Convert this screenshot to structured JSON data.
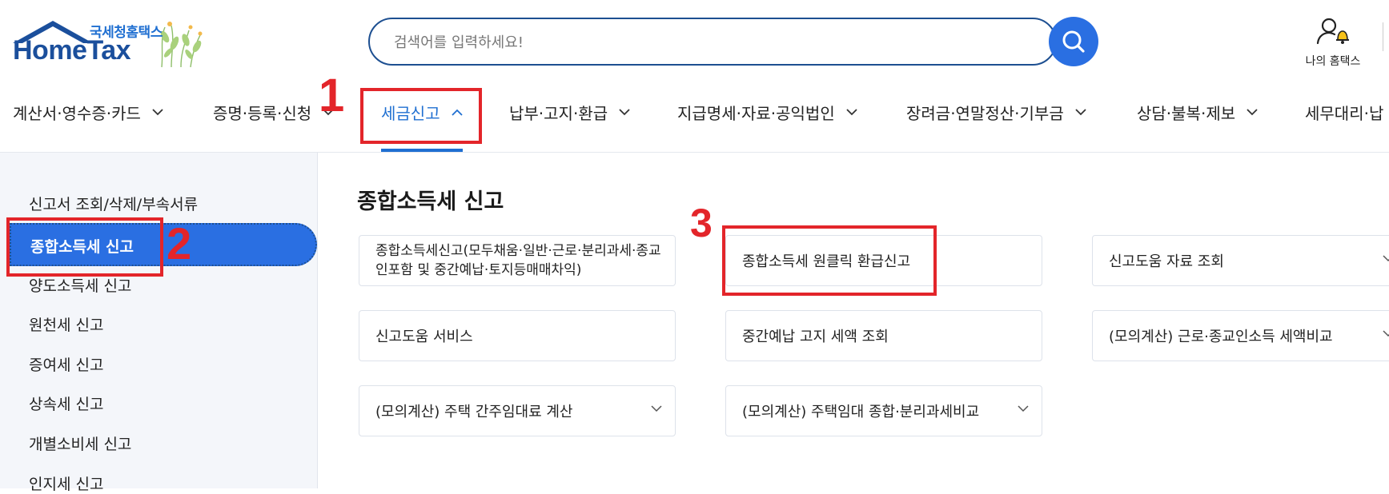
{
  "header": {
    "logo_sub": "국세청홈택스",
    "logo_main": "HomeTax",
    "search_placeholder": "검색어를 입력하세요!",
    "my_hometax_label": "나의 홈택스"
  },
  "gnb": {
    "items": [
      {
        "label": "계산서·영수증·카드"
      },
      {
        "label": "증명·등록·신청"
      },
      {
        "label": "세금신고"
      },
      {
        "label": "납부·고지·환급"
      },
      {
        "label": "지급명세·자료·공익법인"
      },
      {
        "label": "장려금·연말정산·기부금"
      },
      {
        "label": "상담·불복·제보"
      },
      {
        "label": "세무대리·납"
      }
    ],
    "active_index": 2
  },
  "sidebar": {
    "items": [
      {
        "label": "신고서 조회/삭제/부속서류"
      },
      {
        "label": "종합소득세 신고"
      },
      {
        "label": "양도소득세 신고"
      },
      {
        "label": "원천세 신고"
      },
      {
        "label": "증여세 신고"
      },
      {
        "label": "상속세 신고"
      },
      {
        "label": "개별소비세 신고"
      },
      {
        "label": "인지세 신고"
      }
    ],
    "active_index": 1
  },
  "main": {
    "title": "종합소득세 신고",
    "cards": [
      {
        "label": "종합소득세신고(모두채움·일반·근로·분리과세·종교인포함 및 중간예납·토지등매매차익)",
        "has_dropdown": false
      },
      {
        "label": "종합소득세 원클릭 환급신고",
        "has_dropdown": false
      },
      {
        "label": "신고도움 자료 조회",
        "has_dropdown": true
      },
      {
        "label": "신고도움 서비스",
        "has_dropdown": false
      },
      {
        "label": "중간예납 고지 세액 조회",
        "has_dropdown": false
      },
      {
        "label": "(모의계산) 근로·종교인소득 세액비교",
        "has_dropdown": true
      },
      {
        "label": "(모의계산) 주택 간주임대료 계산",
        "has_dropdown": true
      },
      {
        "label": "(모의계산) 주택임대 종합·분리과세비교",
        "has_dropdown": true
      }
    ]
  },
  "annotations": {
    "step1": "1",
    "step2": "2",
    "step3": "3",
    "color": "#e3252a"
  },
  "colors": {
    "brand_blue": "#2a6fe2",
    "navy": "#1d4f91",
    "active_text": "#1f6fd1"
  }
}
